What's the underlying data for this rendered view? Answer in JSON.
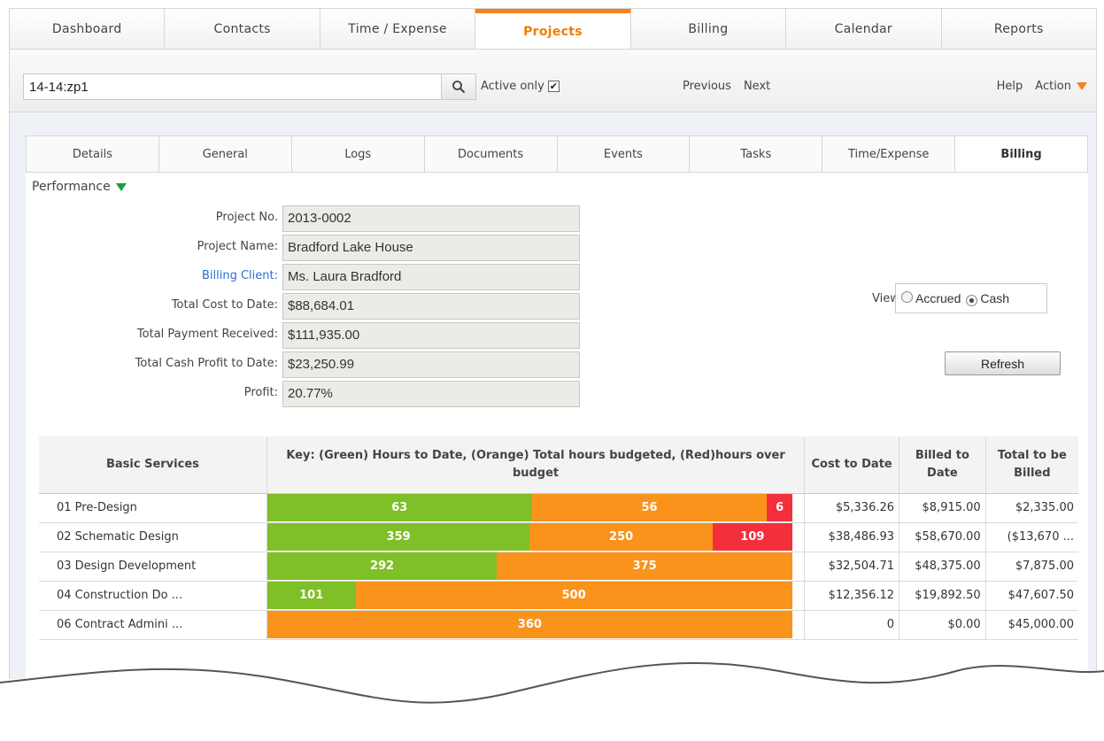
{
  "topnav": {
    "tabs": [
      {
        "label": "Dashboard"
      },
      {
        "label": "Contacts"
      },
      {
        "label": "Time / Expense"
      },
      {
        "label": "Projects"
      },
      {
        "label": "Billing"
      },
      {
        "label": "Calendar"
      },
      {
        "label": "Reports"
      }
    ],
    "active_index": 3
  },
  "toolbar": {
    "search_value": "14-14:zp1",
    "active_only_label": "Active only",
    "active_only_checked": true,
    "previous_label": "Previous",
    "next_label": "Next",
    "help_label": "Help",
    "action_label": "Action"
  },
  "subtabs": {
    "tabs": [
      {
        "label": "Details"
      },
      {
        "label": "General"
      },
      {
        "label": "Logs"
      },
      {
        "label": "Documents"
      },
      {
        "label": "Events"
      },
      {
        "label": "Tasks"
      },
      {
        "label": "Time/Expense"
      },
      {
        "label": "Billing"
      }
    ],
    "active_index": 7
  },
  "performance": {
    "title": "Performance",
    "fields": [
      {
        "label": "Project No.",
        "value": "2013-0002"
      },
      {
        "label": "Project Name:",
        "value": "Bradford Lake House"
      },
      {
        "label": "Billing Client:",
        "value": "Ms. Laura Bradford"
      },
      {
        "label": "Total Cost to Date:",
        "value": "$88,684.01"
      },
      {
        "label": "Total Payment Received:",
        "value": "$111,935.00"
      },
      {
        "label": "Total Cash Profit to Date:",
        "value": "$23,250.99"
      },
      {
        "label": "Profit:",
        "value": "20.77%"
      }
    ],
    "view_label": "View",
    "view_options": [
      "Accrued",
      "Cash"
    ],
    "view_selected": "Cash",
    "refresh_label": "Refresh"
  },
  "services_table": {
    "headers": {
      "service": "Basic Services",
      "key": "Key: (Green) Hours to Date, (Orange) Total hours budgeted, (Red)hours over budget",
      "cost": "Cost to Date",
      "billed": "Billed to Date",
      "total": "Total to be Billed"
    },
    "rows": [
      {
        "name": "01 Pre-Design",
        "green": 63,
        "orange": 56,
        "red": 6,
        "cost": "$5,336.26",
        "billed": "$8,915.00",
        "total": "$2,335.00"
      },
      {
        "name": "02 Schematic Design",
        "green": 359,
        "orange": 250,
        "red": 109,
        "cost": "$38,486.93",
        "billed": "$58,670.00",
        "total": "($13,670 ..."
      },
      {
        "name": "03 Design Development",
        "green": 292,
        "orange": 375,
        "red": null,
        "cost": "$32,504.71",
        "billed": "$48,375.00",
        "total": "$7,875.00"
      },
      {
        "name": "04 Construction Do ...",
        "green": 101,
        "orange": 500,
        "red": null,
        "cost": "$12,356.12",
        "billed": "$19,892.50",
        "total": "$47,607.50"
      },
      {
        "name": "06 Contract Admini ...",
        "green": null,
        "orange": 360,
        "red": null,
        "cost": "0",
        "billed": "$0.00",
        "total": "$45,000.00"
      }
    ]
  },
  "colors": {
    "accent_orange": "#f5821f",
    "bar_green": "#7fbf27",
    "bar_orange": "#f9931c",
    "bar_red": "#f32f3c",
    "link_blue": "#2b6fd6",
    "perf_triangle": "#13a03f"
  }
}
